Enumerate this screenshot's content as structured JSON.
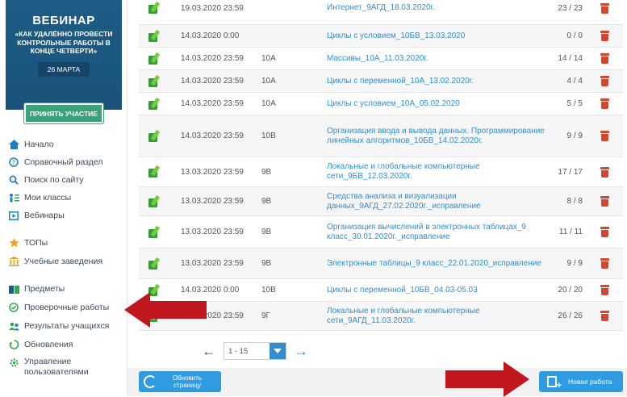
{
  "banner": {
    "title": "ВЕБИНАР",
    "subtitle": "«КАК УДАЛЁННО ПРОВЕСТИ КОНТРОЛЬНЫЕ РАБОТЫ В КОНЦЕ ЧЕТВЕРТИ»",
    "date": "26 МАРТА",
    "join_label": "ПРИНЯТЬ УЧАСТИЕ"
  },
  "nav": [
    {
      "label": "Начало",
      "icon": "home-icon"
    },
    {
      "label": "Справочный раздел",
      "icon": "help-icon"
    },
    {
      "label": "Поиск по сайту",
      "icon": "search-icon"
    },
    {
      "label": "Мои классы",
      "icon": "classes-icon"
    },
    {
      "label": "Вебинары",
      "icon": "webinar-icon"
    },
    {
      "label": "ТОПы",
      "icon": "star-icon"
    },
    {
      "label": "Учебные заведения",
      "icon": "school-icon"
    },
    {
      "label": "Предметы",
      "icon": "subjects-icon"
    },
    {
      "label": "Проверочные работы",
      "icon": "check-icon"
    },
    {
      "label": "Результаты учащихся",
      "icon": "results-icon"
    },
    {
      "label": "Обновления",
      "icon": "updates-icon"
    },
    {
      "label": "Управление пользователями",
      "icon": "users-icon"
    }
  ],
  "rows": [
    {
      "date": "19.03.2020 23:59",
      "class": "",
      "name": "Интернет_9АГД_18.03.2020г.",
      "score": "23 / 23"
    },
    {
      "date": "14.03.2020 0:00",
      "class": "",
      "name": "Циклы с условием_10БВ_13.03.2020",
      "score": "0 / 0"
    },
    {
      "date": "14.03.2020 23:59",
      "class": "10А",
      "name": "Массивы_10А_11.03.2020г.",
      "score": "14 / 14"
    },
    {
      "date": "14.03.2020 23:59",
      "class": "10А",
      "name": "Циклы с переменной_10А_13.02.2020г.",
      "score": "4 / 4"
    },
    {
      "date": "14.03.2020 23:59",
      "class": "10А",
      "name": "Циклы с условием_10А_05.02.2020",
      "score": "5 / 5"
    },
    {
      "date": "14.03.2020 23:59",
      "class": "10В",
      "name": "Организация ввода и вывода данных. Программирование линейных алгоритмов_10БВ_14.02.2020г.",
      "score": "9 / 9"
    },
    {
      "date": "13.03.2020 23:59",
      "class": "9В",
      "name": "Локальные и глобальные компьютерные сети_9БВ_12.03.2020г.",
      "score": "17 / 17"
    },
    {
      "date": "13.03.2020 23:59",
      "class": "9В",
      "name": "Средства анализа и визуализации данных_9АГД_27.02.2020г._исправление",
      "score": "8 / 8"
    },
    {
      "date": "13.03.2020 23:59",
      "class": "9В",
      "name": "Организация вычислений в электронных таблицах_9 класс_30.01.2020г._исправление",
      "score": "11 / 11"
    },
    {
      "date": "13.03.2020 23:59",
      "class": "9В",
      "name": "Электронные таблицы_9 класс_22.01.2020_исправление",
      "score": "9 / 9"
    },
    {
      "date": "14.03.2020 0:00",
      "class": "10В",
      "name": "Циклы с переменной_10БВ_04.03-05.03",
      "score": "20 / 20"
    },
    {
      "date": "12.03.2020 23:59",
      "class": "9Г",
      "name": "Локальные и глобальные компьютерные сети_9АГД_11.03.2020г.",
      "score": "26 / 26"
    }
  ],
  "pager": {
    "prev": "←",
    "next": "→",
    "range": "1 - 15"
  },
  "buttons": {
    "refresh": "Обновить страницу",
    "new_work": "Новая работа"
  }
}
